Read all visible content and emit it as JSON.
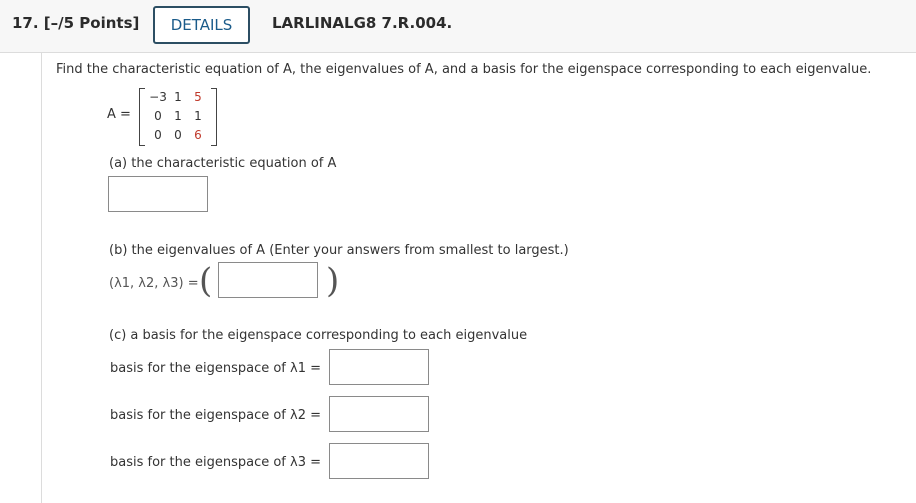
{
  "header": {
    "question_number": "17.  [–/5 Points]",
    "details_label": "DETAILS",
    "question_code": "LARLINALG8 7.R.004."
  },
  "prompt": "Find the characteristic equation of A, the eigenvalues of A, and a basis for the eigenspace corresponding to each eigenvalue.",
  "matrix": {
    "label": "A =",
    "rows": [
      [
        "−3",
        "1",
        "5"
      ],
      [
        "0",
        "1",
        "1"
      ],
      [
        "0",
        "0",
        "6"
      ]
    ],
    "highlight_color": "#c0392b"
  },
  "part_a": {
    "label": "(a) the characteristic equation of A",
    "input_value": ""
  },
  "part_b": {
    "label": "(b) the eigenvalues of A (Enter your answers from smallest to largest.)",
    "tuple_label": "(λ1, λ2, λ3) =",
    "input_value": ""
  },
  "part_c": {
    "label": "(c) a basis for the eigenspace corresponding to each eigenvalue",
    "rows": [
      {
        "label": "basis for the eigenspace of λ1  =",
        "input_value": ""
      },
      {
        "label": "basis for the eigenspace of λ2  =",
        "input_value": ""
      },
      {
        "label": "basis for the eigenspace of λ3  =",
        "input_value": ""
      }
    ]
  },
  "colors": {
    "details_border": "#2c4e63",
    "details_text": "#1a5b8a",
    "header_bg": "#f7f7f7"
  }
}
